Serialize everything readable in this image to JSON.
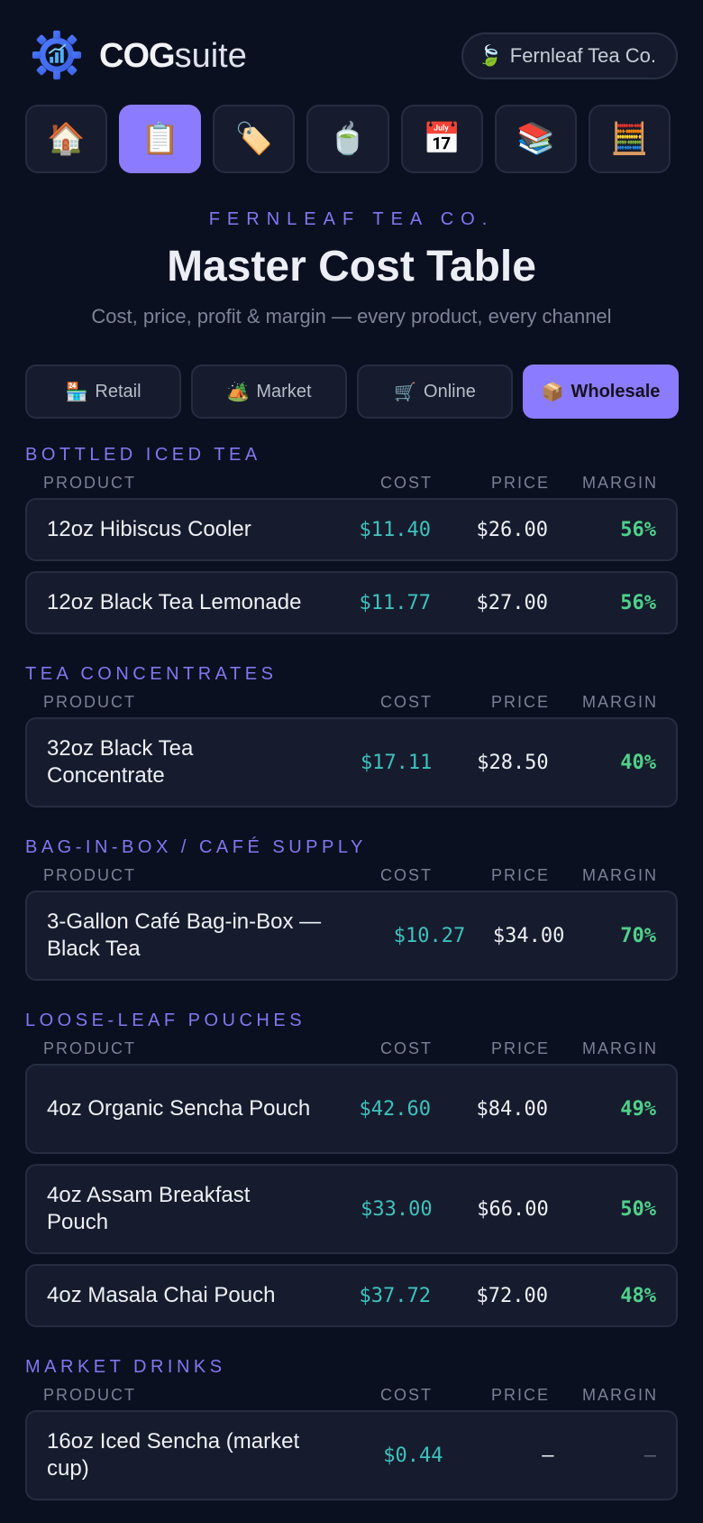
{
  "header": {
    "brand_bold": "COG",
    "brand_light": "suite",
    "org_icon": "🍃",
    "org_name": "Fernleaf Tea Co."
  },
  "nav": [
    {
      "icon": "🏠",
      "name": "home"
    },
    {
      "icon": "📋",
      "name": "cost-table",
      "active": true
    },
    {
      "icon": "🏷️",
      "name": "pricing"
    },
    {
      "icon": "🍵",
      "name": "recipes"
    },
    {
      "icon": "📅",
      "name": "calendar"
    },
    {
      "icon": "📚",
      "name": "library"
    },
    {
      "icon": "🧮",
      "name": "calculator"
    }
  ],
  "hero": {
    "eyebrow": "FERNLEAF TEA CO.",
    "title": "Master Cost Table",
    "subtitle": "Cost, price, profit & margin — every product, every channel"
  },
  "channels": [
    {
      "icon": "🏪",
      "label": "Retail"
    },
    {
      "icon": "🏕️",
      "label": "Market"
    },
    {
      "icon": "🛒",
      "label": "Online"
    },
    {
      "icon": "📦",
      "label": "Wholesale",
      "active": true
    }
  ],
  "columns": {
    "product": "PRODUCT",
    "cost": "COST",
    "price": "PRICE",
    "margin": "MARGIN"
  },
  "sections": [
    {
      "title": "BOTTLED ICED TEA",
      "rows": [
        {
          "product": "12oz Hibiscus Cooler",
          "cost": "$11.40",
          "price": "$26.00",
          "margin": "56%"
        },
        {
          "product": "12oz Black Tea Lemonade",
          "cost": "$11.77",
          "price": "$27.00",
          "margin": "56%"
        }
      ]
    },
    {
      "title": "TEA CONCENTRATES",
      "rows": [
        {
          "product": "32oz Black Tea Concentrate",
          "cost": "$17.11",
          "price": "$28.50",
          "margin": "40%"
        }
      ]
    },
    {
      "title": "BAG-IN-BOX / CAFÉ SUPPLY",
      "rows": [
        {
          "product": "3-Gallon Café Bag-in-Box — Black Tea",
          "cost": "$10.27",
          "price": "$34.00",
          "margin": "70%"
        }
      ]
    },
    {
      "title": "LOOSE-LEAF POUCHES",
      "rows": [
        {
          "product": "4oz Organic Sencha Pouch",
          "cost": "$42.60",
          "price": "$84.00",
          "margin": "49%"
        },
        {
          "product": "4oz Assam Breakfast Pouch",
          "cost": "$33.00",
          "price": "$66.00",
          "margin": "50%"
        },
        {
          "product": "4oz Masala Chai Pouch",
          "cost": "$37.72",
          "price": "$72.00",
          "margin": "48%"
        }
      ]
    },
    {
      "title": "MARKET DRINKS",
      "rows": [
        {
          "product": "16oz Iced Sencha (market cup)",
          "cost": "$0.44",
          "price": "—",
          "margin": "—"
        }
      ]
    }
  ]
}
